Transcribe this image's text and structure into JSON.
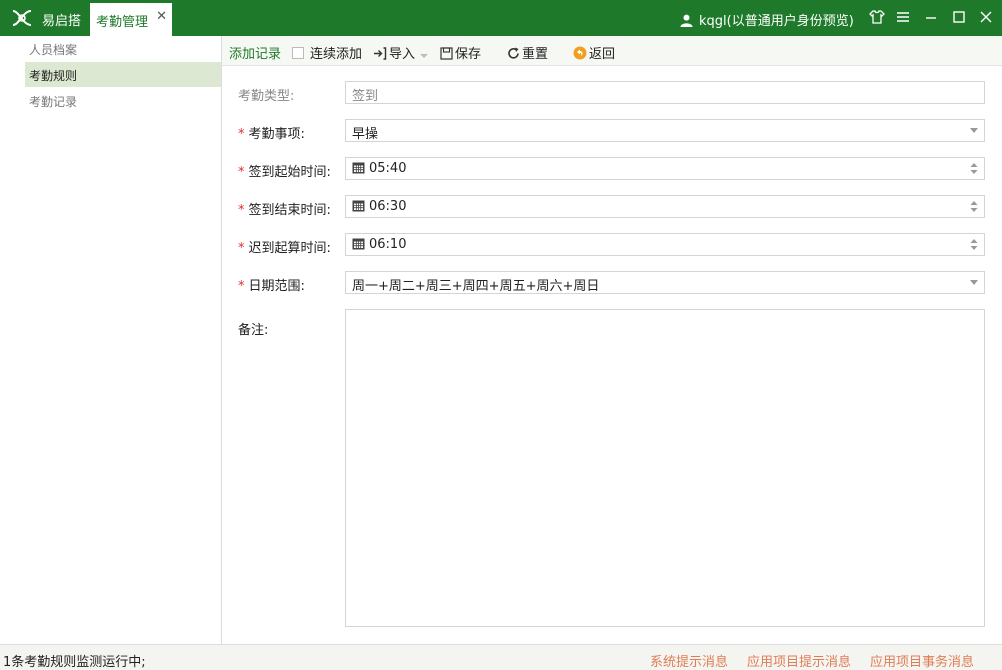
{
  "titlebar": {
    "app_name": "易启搭",
    "active_tab": "考勤管理",
    "tab_close": "✕",
    "user": "kqgl(以普通用户身份预览)"
  },
  "sidebar": {
    "items": [
      {
        "label": "人员档案",
        "active": false
      },
      {
        "label": "考勤规则",
        "active": true
      },
      {
        "label": "考勤记录",
        "active": false
      }
    ]
  },
  "toolbar": {
    "add_record": "添加记录",
    "continuous_add": "连续添加",
    "import": "导入",
    "save": "保存",
    "reset": "重置",
    "back": "返回"
  },
  "form": {
    "type_label": "考勤类型:",
    "type_value": "签到",
    "item_label": "考勤事项:",
    "item_value": "早操",
    "start_label": "签到起始时间:",
    "start_value": "05:40",
    "end_label": "签到结束时间:",
    "end_value": "06:30",
    "late_label": "迟到起算时间:",
    "late_value": "06:10",
    "range_label": "日期范围:",
    "range_value": "周一+周二+周三+周四+周五+周六+周日",
    "remark_label": "备注:",
    "required_mark": "*"
  },
  "statusbar": {
    "left": "1条考勤规则监测运行中;",
    "links": [
      "系统提示消息",
      "应用项目提示消息",
      "应用项目事务消息"
    ]
  },
  "colors": {
    "brand": "#1e7a2a",
    "required": "#e0302d",
    "status_link": "#e07c55",
    "back_icon": "#f0a020"
  }
}
